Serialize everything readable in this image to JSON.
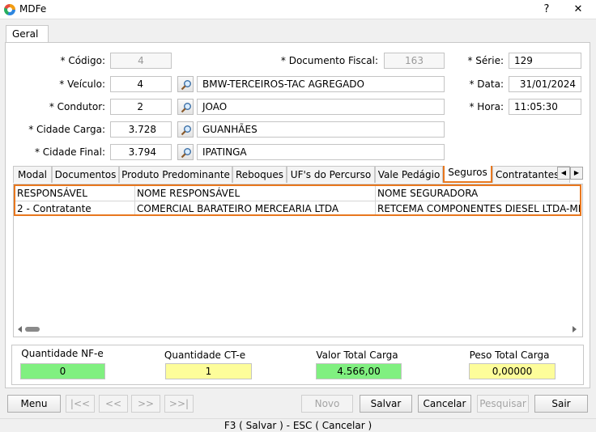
{
  "window": {
    "title": "MDFe",
    "help": "?",
    "close": "✕"
  },
  "main_tab": {
    "label": "Geral"
  },
  "form": {
    "codigo_label": "* Código:",
    "codigo_value": "4",
    "doc_fiscal_label": "* Documento Fiscal:",
    "doc_fiscal_value": "163",
    "serie_label": "* Série:",
    "serie_value": "129",
    "veiculo_label": "* Veículo:",
    "veiculo_code": "4",
    "veiculo_desc": "BMW-TERCEIROS-TAC AGREGADO",
    "data_label": "* Data:",
    "data_value": "31/01/2024",
    "condutor_label": "* Condutor:",
    "condutor_code": "2",
    "condutor_desc": "JOAO",
    "hora_label": "* Hora:",
    "hora_value": "11:05:30",
    "cidade_carga_label": "* Cidade Carga:",
    "cidade_carga_code": "3.728",
    "cidade_carga_desc": "GUANHÃES",
    "cidade_final_label": "* Cidade Final:",
    "cidade_final_code": "3.794",
    "cidade_final_desc": "IPATINGA"
  },
  "inner_tabs": [
    "Modal",
    "Documentos",
    "Produto Predominante",
    "Reboques",
    "UF's do Percurso",
    "Vale Pedágio",
    "Seguros",
    "Contratantes"
  ],
  "grid": {
    "headers": [
      "RESPONSÁVEL",
      "NOME RESPONSÁVEL",
      "NOME SEGURADORA"
    ],
    "rows": [
      [
        "2 - Contratante",
        "COMERCIAL BARATEIRO MERCEARIA LTDA",
        "RETCEMA COMPONENTES DIESEL LTDA-ME"
      ]
    ]
  },
  "totals": {
    "qtd_nfe_label": "Quantidade NF-e",
    "qtd_nfe_value": "0",
    "qtd_cte_label": "Quantidade CT-e",
    "qtd_cte_value": "1",
    "valor_label": "Valor Total Carga",
    "valor_value": "4.566,00",
    "peso_label": "Peso Total Carga",
    "peso_value": "0,00000",
    "colors": {
      "green": "#80f080",
      "yellow": "#fdfd9a"
    }
  },
  "buttons": {
    "menu": "Menu",
    "first": "|<<",
    "prev": "<<",
    "next": ">>",
    "last": ">>|",
    "novo": "Novo",
    "salvar": "Salvar",
    "cancelar": "Cancelar",
    "pesquisar": "Pesquisar",
    "sair": "Sair"
  },
  "status": {
    "text": "F3 ( Salvar )   -   ESC ( Cancelar )"
  },
  "accent": "#e8771e"
}
